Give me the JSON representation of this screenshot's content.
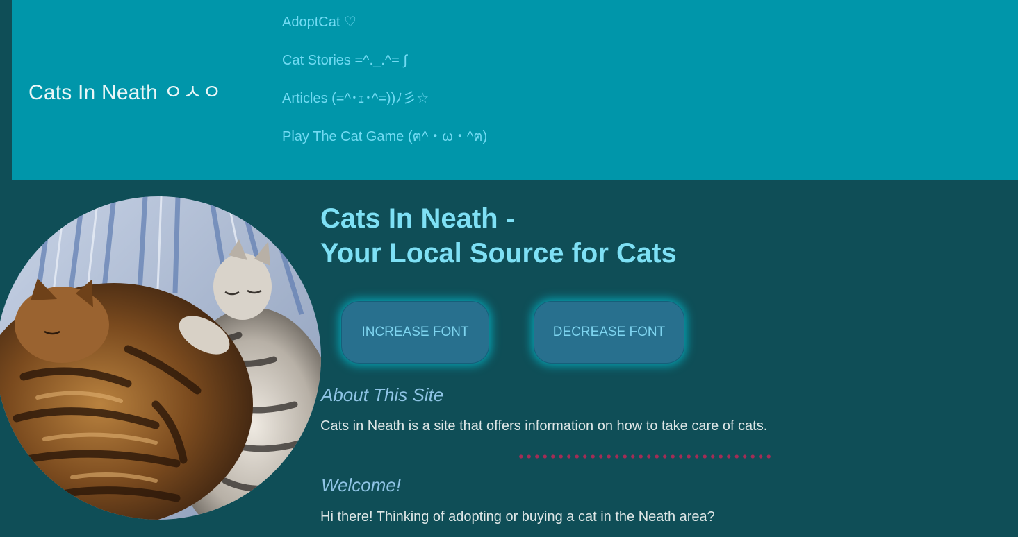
{
  "header": {
    "brand": "Cats In Neath ㅇㅅㅇ",
    "nav": [
      {
        "label": "AdoptCat ♡"
      },
      {
        "label": "Cat Stories =^._.^= ∫"
      },
      {
        "label": "Articles (=^･ｪ･^=))ﾉ彡☆"
      },
      {
        "label": "Play The Cat Game (ฅ^・ω・^ฅ)"
      }
    ]
  },
  "hero": {
    "title_line1": "Cats In Neath -",
    "title_line2": "Your Local Source for Cats"
  },
  "controls": {
    "increase_label": "INCREASE FONT",
    "decrease_label": "DECREASE FONT"
  },
  "about": {
    "heading": "About This Site",
    "text": "Cats in Neath is a site that offers information on how to take care of cats."
  },
  "welcome": {
    "heading": "Welcome!",
    "text": "Hi there! Thinking of adopting or buying a cat in the Neath area?"
  },
  "colors": {
    "header_bg": "#0096aa",
    "page_bg": "#0f4e57",
    "nav_link": "#72dbf3",
    "title": "#7ee0f5",
    "button_bg": "#28708e",
    "divider": "#a42c55"
  }
}
